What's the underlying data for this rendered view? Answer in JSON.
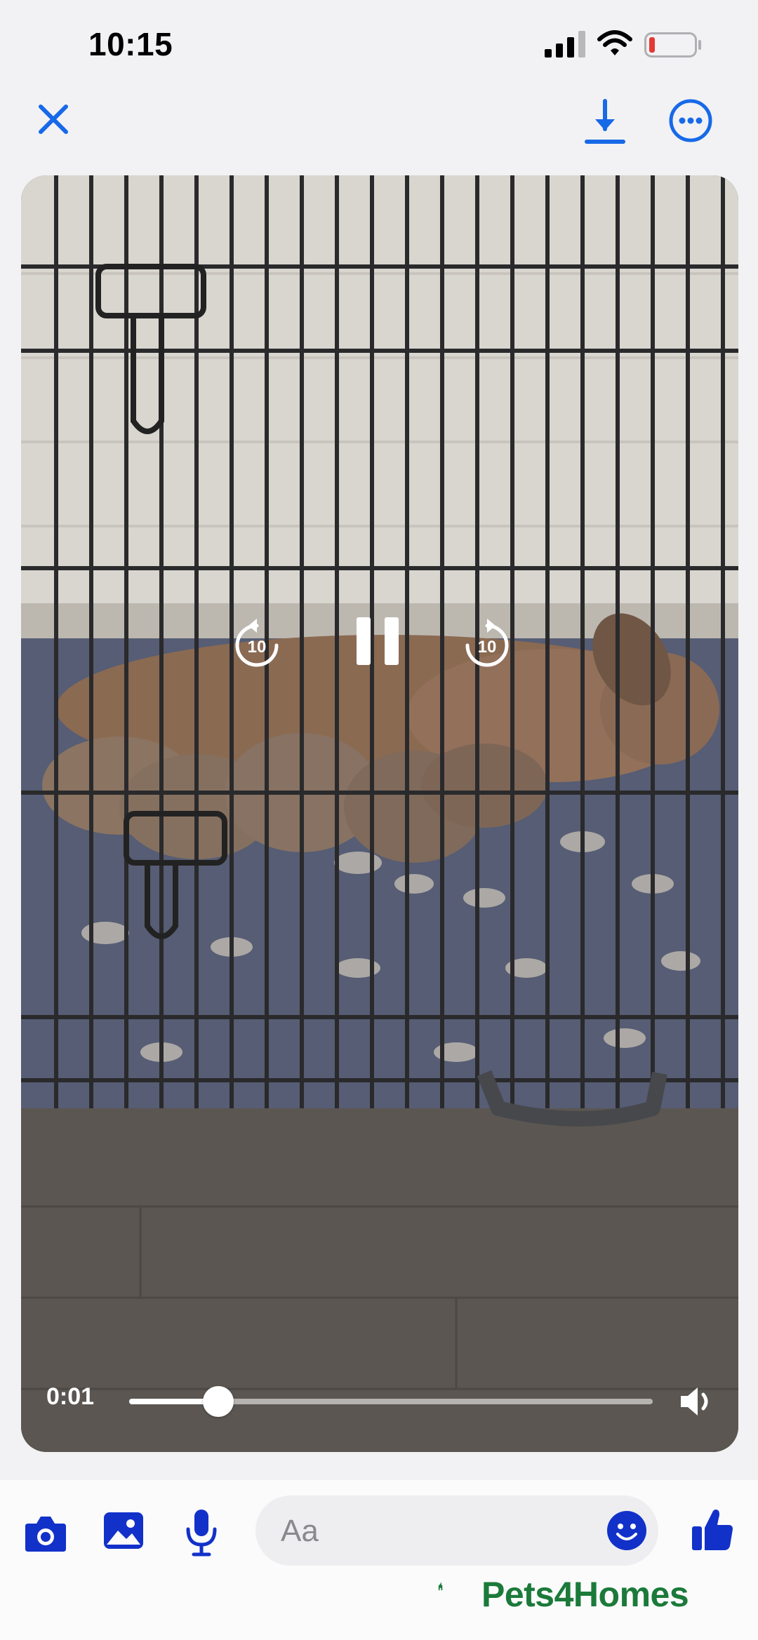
{
  "status_bar": {
    "time": "10:15",
    "signal_icon": "cellular-signal-icon",
    "wifi_icon": "wifi-icon",
    "battery_icon": "battery-low-icon",
    "battery_color": "#e53935"
  },
  "top_bar": {
    "close_icon": "close-icon",
    "download_icon": "download-icon",
    "more_icon": "more-options-icon",
    "accent_color": "#1769e8"
  },
  "video": {
    "current_time": "0:01",
    "progress": 0.17,
    "rewind_label": "10",
    "forward_label": "10",
    "state": "playing"
  },
  "composer": {
    "placeholder": "Aa",
    "icons": [
      "camera-icon",
      "photo-gallery-icon",
      "microphone-icon",
      "emoji-icon",
      "thumbs-up-icon"
    ],
    "accent_color": "#1231c9"
  },
  "watermark": {
    "text": "Pets4Homes",
    "color": "#1b7a3a"
  }
}
